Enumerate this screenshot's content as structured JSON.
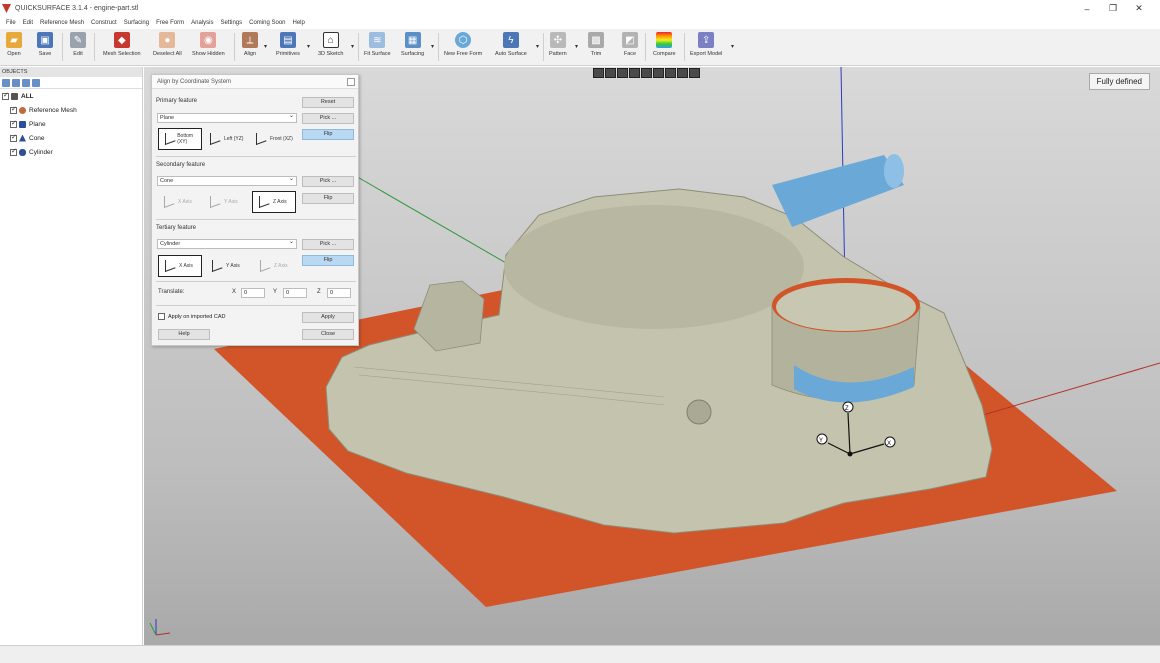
{
  "app": {
    "title": "QUICKSURFACE 3.1.4 - engine-part.stl"
  },
  "window": {
    "minimize": "–",
    "maximize": "❐",
    "close": "✕"
  },
  "menu": [
    "File",
    "Edit",
    "Reference Mesh",
    "Construct",
    "Surfacing",
    "Free Form",
    "Analysis",
    "Settings",
    "Coming Soon",
    "Help"
  ],
  "toolbar": {
    "open": "Open",
    "save": "Save",
    "edit": "Edit",
    "mesh_selection": "Mesh Selection",
    "deselect_all": "Deselect All",
    "show_hidden": "Show Hidden",
    "align": "Align",
    "primitives": "Primitives",
    "sketch_3d": "3D Sketch",
    "fit_surface": "Fit Surface",
    "surfacing": "Surfacing",
    "new_free_form": "New Free Form",
    "auto_surface": "Auto Surface",
    "pattern": "Pattern",
    "trim": "Trim",
    "face": "Face",
    "compare": "Compare",
    "export_model": "Export Model"
  },
  "objects": {
    "header": "OBJECTS",
    "root": "ALL",
    "items": [
      "Reference Mesh",
      "Plane",
      "Cone",
      "Cylinder"
    ]
  },
  "viewport": {
    "status_badge": "Fully defined",
    "axis_x": "X",
    "axis_y": "Y",
    "axis_z": "Z"
  },
  "dialog": {
    "title": "Align by Coordinate System",
    "primary_label": "Primary feature",
    "primary_value": "Plane",
    "reset": "Reset",
    "pick": "Pick ...",
    "flip": "Flip",
    "primary_axes": [
      "Bottom (XY)",
      "Left (YZ)",
      "Front (XZ)"
    ],
    "secondary_label": "Secondary feature",
    "secondary_value": "Cone",
    "secondary_axes": [
      "X Axis",
      "Y Axis",
      "Z Axis"
    ],
    "tertiary_label": "Tertiary feature",
    "tertiary_value": "Cylinder",
    "tertiary_axes": [
      "X Axis",
      "Y Axis",
      "Z Axis"
    ],
    "translate_label": "Translate:",
    "tx_label": "X",
    "tx": "0",
    "ty_label": "Y",
    "ty": "0",
    "tz_label": "Z",
    "tz": "0",
    "apply_checkbox": "Apply on imported CAD",
    "apply": "Apply",
    "help": "Help",
    "close": "Close"
  },
  "colors": {
    "plane": "#d2552a",
    "mesh": "#c4c4ae",
    "blue_region": "#6aa8d8",
    "accent": "#2a6fd6"
  }
}
